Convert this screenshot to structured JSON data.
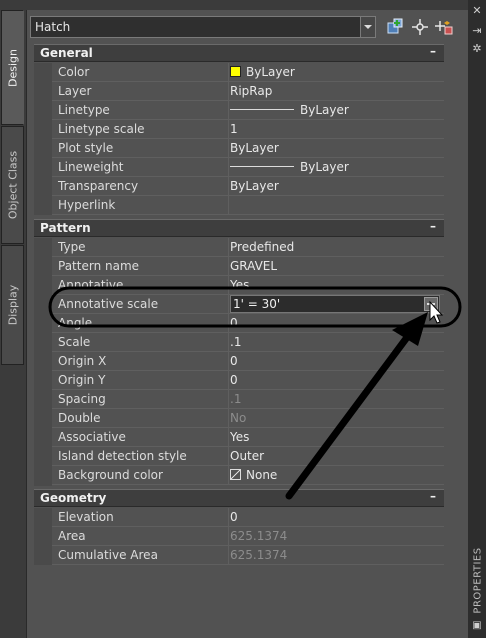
{
  "left_tabs": [
    "Design",
    "Object Class",
    "Display"
  ],
  "selector": {
    "value": "Hatch"
  },
  "toolbar": {
    "icons": [
      "select-objects-icon",
      "quick-select-icon",
      "toggle-pickadd-icon"
    ]
  },
  "right_strip": {
    "title": "PROPERTIES",
    "icons": [
      "close-icon",
      "autohide-icon",
      "properties-menu-icon"
    ]
  },
  "sections": {
    "general": {
      "title": "General",
      "collapse": "–",
      "rows": [
        {
          "label": "Color",
          "value": "ByLayer"
        },
        {
          "label": "Layer",
          "value": "RipRap"
        },
        {
          "label": "Linetype",
          "value": "ByLayer"
        },
        {
          "label": "Linetype scale",
          "value": "1"
        },
        {
          "label": "Plot style",
          "value": "ByLayer"
        },
        {
          "label": "Lineweight",
          "value": "ByLayer"
        },
        {
          "label": "Transparency",
          "value": "ByLayer"
        },
        {
          "label": "Hyperlink",
          "value": ""
        }
      ]
    },
    "pattern": {
      "title": "Pattern",
      "collapse": "–",
      "rows": [
        {
          "label": "Type",
          "value": "Predefined"
        },
        {
          "label": "Pattern name",
          "value": "GRAVEL"
        },
        {
          "label": "Annotative",
          "value": "Yes"
        },
        {
          "label": "Annotative scale",
          "value": "1' = 30'"
        },
        {
          "label": "Angle",
          "value": "0"
        },
        {
          "label": "Scale",
          "value": ".1"
        },
        {
          "label": "Origin X",
          "value": "0"
        },
        {
          "label": "Origin Y",
          "value": "0"
        },
        {
          "label": "Spacing",
          "value": ".1"
        },
        {
          "label": "Double",
          "value": "No"
        },
        {
          "label": "Associative",
          "value": "Yes"
        },
        {
          "label": "Island detection style",
          "value": "Outer"
        },
        {
          "label": "Background color",
          "value": "None"
        }
      ]
    },
    "geometry": {
      "title": "Geometry",
      "collapse": "–",
      "rows": [
        {
          "label": "Elevation",
          "value": "0"
        },
        {
          "label": "Area",
          "value": "625.1374"
        },
        {
          "label": "Cumulative Area",
          "value": "625.1374"
        }
      ]
    }
  },
  "colors": {
    "yellow_swatch": "#ffff00",
    "annotation": "#000000"
  }
}
